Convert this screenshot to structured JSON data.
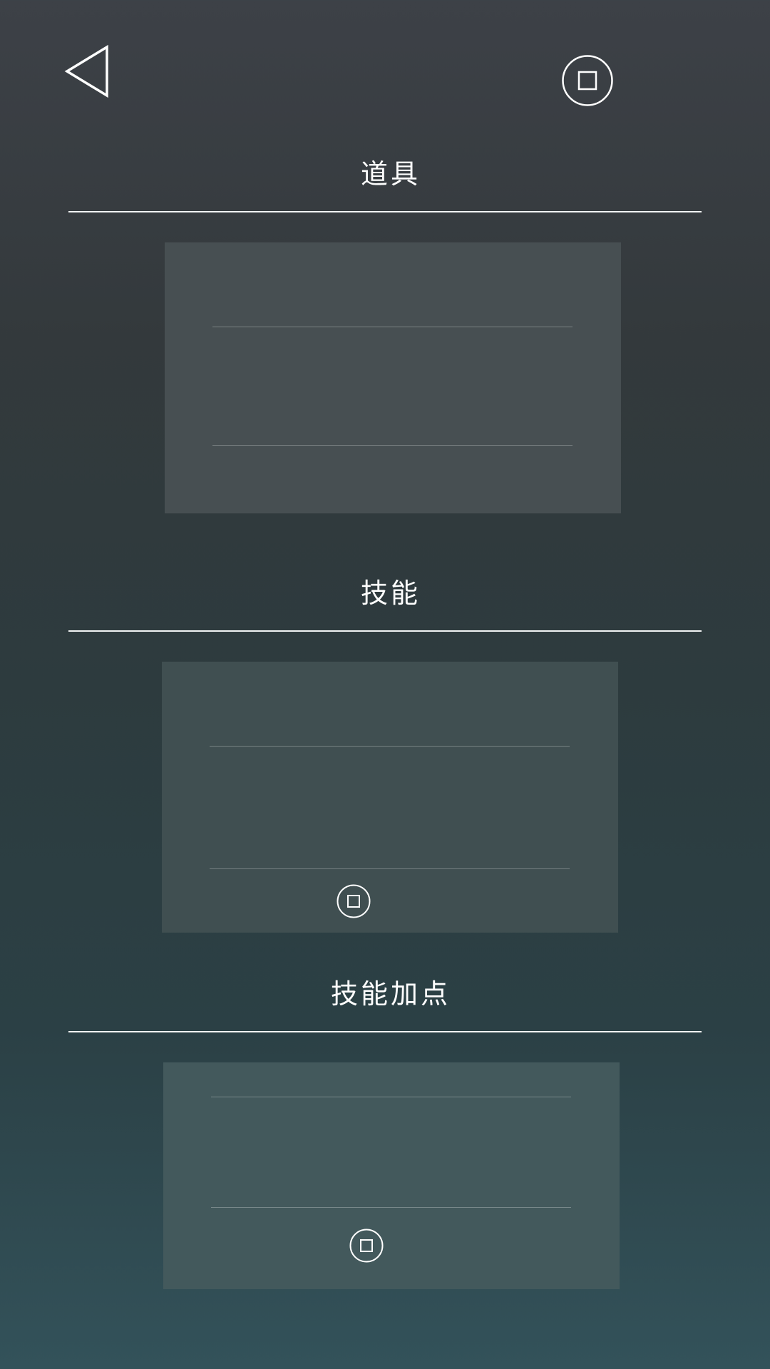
{
  "header": {
    "back_icon": "back-triangle-icon",
    "action_icon": "circle-square-icon"
  },
  "sections": [
    {
      "title": "道具"
    },
    {
      "title": "技能",
      "action_icon": "circle-square-icon"
    },
    {
      "title": "技能加点",
      "action_icon": "circle-square-icon"
    }
  ],
  "colors": {
    "foreground": "#ffffff",
    "panel_1": "#474f52",
    "panel_2": "#404f51",
    "panel_3": "#43595c"
  }
}
